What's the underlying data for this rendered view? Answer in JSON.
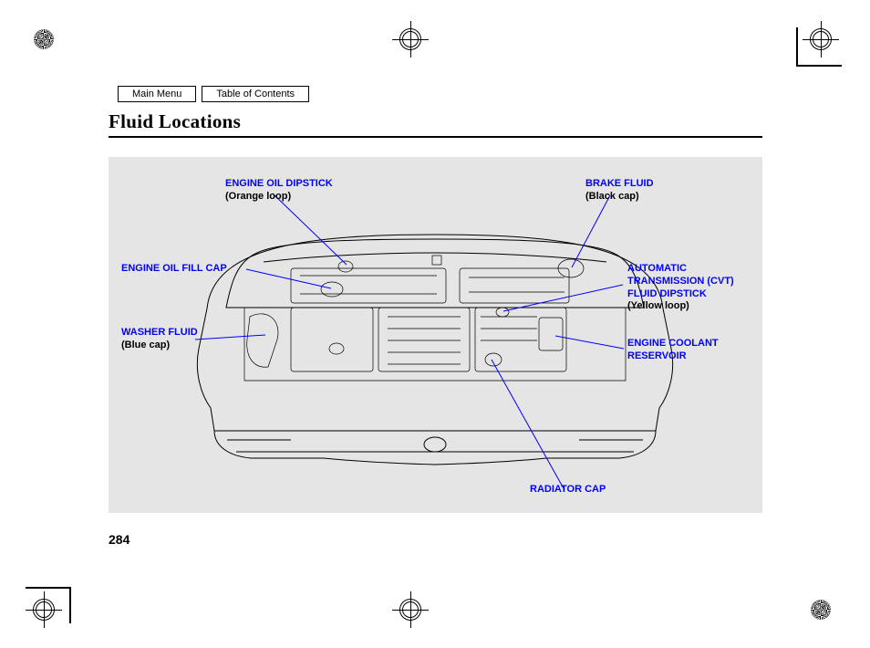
{
  "nav": {
    "main_menu": "Main Menu",
    "toc": "Table of Contents"
  },
  "page": {
    "title": "Fluid Locations",
    "number": "284"
  },
  "labels": {
    "oil_dipstick": {
      "title": "ENGINE OIL DIPSTICK",
      "sub": "(Orange loop)"
    },
    "oil_fill": {
      "title": "ENGINE OIL FILL CAP"
    },
    "washer": {
      "title": "WASHER FLUID",
      "sub": "(Blue cap)"
    },
    "brake": {
      "title": "BRAKE FLUID",
      "sub": "(Black cap)"
    },
    "cvt": {
      "title": "AUTOMATIC",
      "line2": "TRANSMISSION (CVT)",
      "line3": "FLUID DIPSTICK",
      "sub": "(Yellow loop)"
    },
    "coolant": {
      "title": "ENGINE COOLANT",
      "line2": "RESERVOIR"
    },
    "radiator": {
      "title": "RADIATOR CAP"
    }
  }
}
